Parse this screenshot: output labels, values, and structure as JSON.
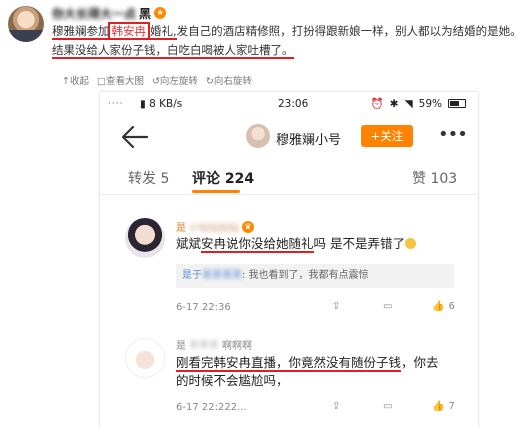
{
  "post": {
    "username_blurred": "你大长得大一点",
    "username_suffix": "黑",
    "lines": [
      {
        "pre": "",
        "name": "穆雅斓参加",
        "hl": "韩安冉",
        "after_hl": "婚礼,",
        "rest": "发自己的酒店精修照，打扮得跟新娘一样，别人都以为结婚的是她。"
      },
      {
        "text": "结果没给人家份子钱，白吃白喝被人家吐槽了。"
      }
    ],
    "tools": [
      "↑收起",
      "□查看大图",
      "↺向左旋转",
      "↻向右旋转"
    ]
  },
  "status_bar": {
    "dots": "····",
    "speed": "8 KB/s",
    "time": "23:06",
    "battery": "59%"
  },
  "nav": {
    "name": "穆雅斓小号",
    "follow": "+关注"
  },
  "tabs": {
    "repost": "转发 5",
    "comments": "评论 224",
    "likes": "赞 103"
  },
  "comments": [
    {
      "name_prefix": "是",
      "name_blurred": "小仙仙仙仙",
      "text_a": "斌斌",
      "text_hl": "安冉",
      "text_b": "说你没给她随礼",
      "text_c": "吗 是不是弄错了",
      "reply_name": "是于",
      "reply_name_blurred": "莱莱莱莱",
      "reply_text": ": 我也看到了，我都有点震惊",
      "time": "6-17 22:36",
      "likes": "6"
    },
    {
      "name_prefix": "是",
      "name_blurred": "不不不",
      "name_suffix": "啊啊啊",
      "line1_a": "刚看完韩安冉直播，你竟然没有随份子钱",
      "line1_b": "，你去",
      "line2": "的时候不会尴尬吗，",
      "time": "6-17 22:222...",
      "likes": "7"
    }
  ]
}
